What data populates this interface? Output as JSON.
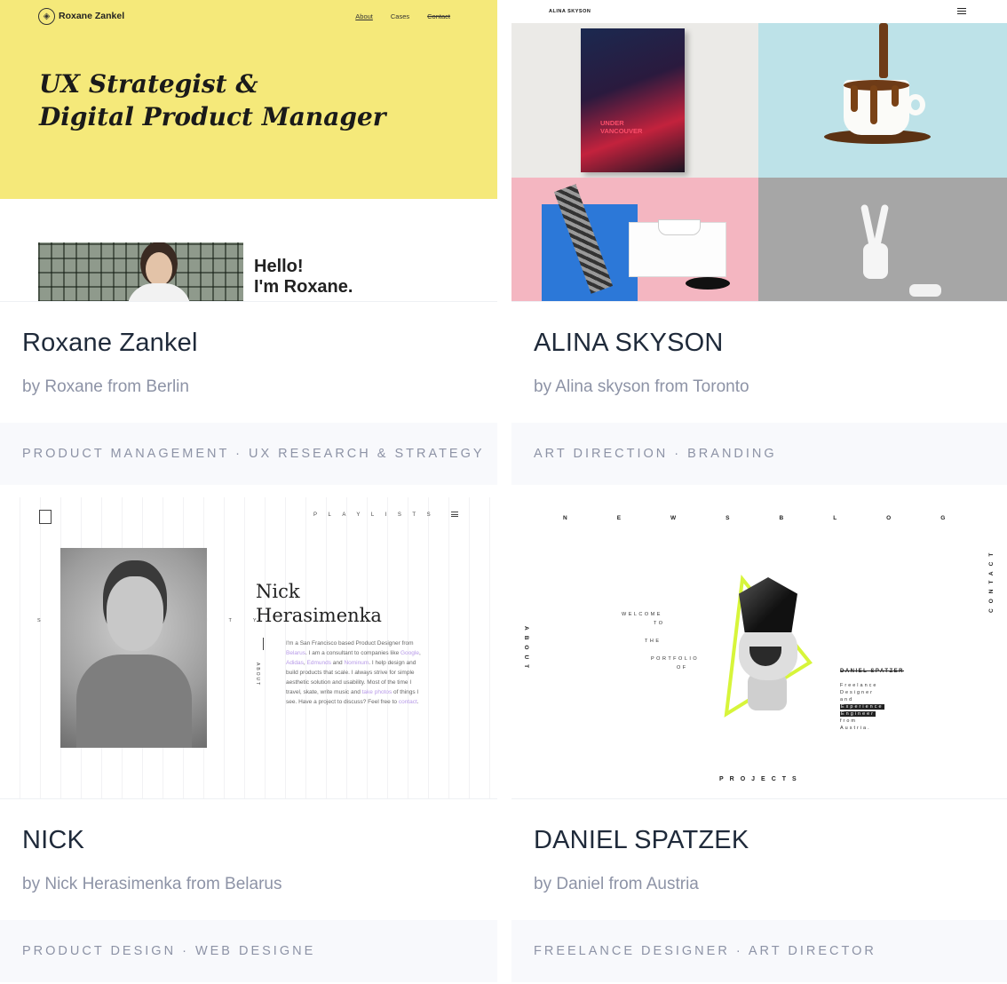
{
  "cards": [
    {
      "title": "Roxane Zankel",
      "byline": "by Roxane from Berlin",
      "tags": "PRODUCT MANAGEMENT · UX RESEARCH & STRATEGY",
      "preview": {
        "brand": "Roxane Zankel",
        "nav": [
          "About",
          "Cases",
          "Contact"
        ],
        "heading_line1": "UX Strategist &",
        "heading_line2": "Digital Product Manager",
        "hello_line1": "Hello!",
        "hello_line2": "I'm Roxane.",
        "colors": {
          "hero_bg": "#f5e97a"
        }
      }
    },
    {
      "title": "ALINA SKYSON",
      "byline": "by Alina skyson from Toronto",
      "tags": "ART DIRECTION · BRANDING",
      "preview": {
        "brand": "ALINA SKYSON",
        "menu_icon": "hamburger-icon",
        "book_text_line1": "UNDER",
        "book_text_line2": "VANCOUVER"
      }
    },
    {
      "title": "NICK",
      "byline": "by Nick Herasimenka from Belarus",
      "tags": "PRODUCT DESIGN · WEB DESIGNE",
      "preview": {
        "nav": "PLAYLISTS",
        "side": "SIMPLICITY",
        "name_line1": "Nick",
        "name_line2": "Herasimenka",
        "about": "ABOUT",
        "bio_1": "I'm a San Francisco based Product Designer from ",
        "bio_link_1": "Belarus",
        "bio_2": ". I am a consultant to companies like ",
        "bio_link_2": "Google",
        "bio_3": ", ",
        "bio_link_3": "Adidas",
        "bio_4": ", ",
        "bio_link_4": "Edmunds",
        "bio_5": " and ",
        "bio_link_5": "Nominum",
        "bio_6": ". I help design and build products that scale. I always strive for simple aesthetic solution and usability. Most of the time I travel, skate, write music and ",
        "bio_link_6": "take photos",
        "bio_7": " of things I see. Have a project to discuss? Feel free to ",
        "bio_link_7": "contact",
        "bio_8": "."
      }
    },
    {
      "title": "DANIEL SPATZEK",
      "byline": "by Daniel from Austria",
      "tags": "FREELANCE DESIGNER · ART DIRECTOR",
      "preview": {
        "nav": "NEWSBLOG",
        "about": "ABOUT",
        "contact": "CONTACT",
        "welcome": [
          "WELCOME",
          "TO",
          "THE",
          "PORTFOLIO",
          "OF"
        ],
        "name": "DANIEL SPATZER",
        "lines": [
          "Freelance",
          "Designer",
          "and"
        ],
        "inv_1": "Experience",
        "inv_2": "Engineer",
        "lines2": [
          "from",
          "Austria."
        ],
        "projects": "PROJECTS",
        "colors": {
          "accent": "#d7f53a"
        }
      }
    }
  ]
}
